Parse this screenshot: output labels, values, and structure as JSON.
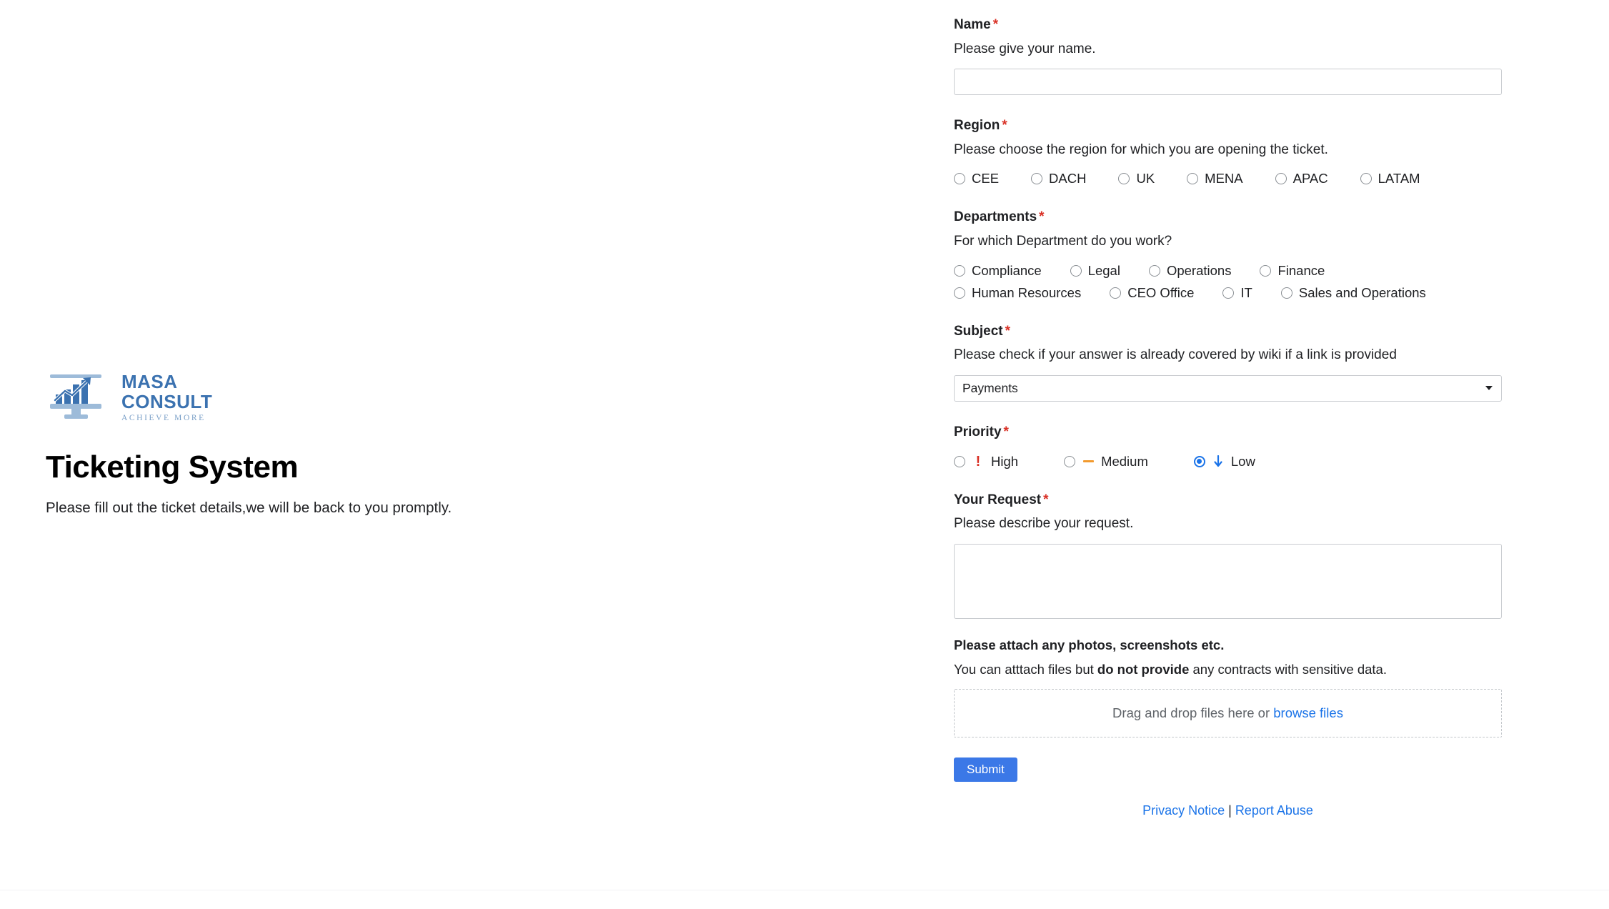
{
  "brand": {
    "logo_word_1": "MASA",
    "logo_word_2": "CONSULT",
    "logo_tagline": "ACHIEVE MORE",
    "logo_icon": "monitor-bar-chart-growth-icon",
    "title": "Ticketing System",
    "subtitle": "Please fill out the ticket details,we will be back to you promptly.",
    "brand_blue": "#3b72b0",
    "brand_light_blue": "#7ba0c8"
  },
  "form": {
    "required_marker": "*",
    "name": {
      "label": "Name",
      "help": "Please give your name.",
      "value": "",
      "placeholder": ""
    },
    "region": {
      "label": "Region",
      "help": "Please choose the region for which you are opening the ticket.",
      "options": [
        "CEE",
        "DACH",
        "UK",
        "MENA",
        "APAC",
        "LATAM"
      ],
      "selected": ""
    },
    "departments": {
      "label": "Departments",
      "help": "For which Department do you work?",
      "row1": [
        "Compliance",
        "Legal",
        "Operations",
        "Finance"
      ],
      "row2": [
        "Human Resources",
        "CEO Office",
        "IT",
        "Sales and Operations"
      ],
      "selected": ""
    },
    "subject": {
      "label": "Subject",
      "help": "Please check if your answer is already covered by wiki if a link is provided",
      "selected": "Payments",
      "caret_icon": "chevron-down-icon"
    },
    "priority": {
      "label": "Priority",
      "options": [
        {
          "label": "High",
          "icon": "exclamation-icon",
          "glyph": "!",
          "color": "#d93025",
          "checked": false
        },
        {
          "label": "Medium",
          "icon": "minus-dash-icon",
          "glyph": "—",
          "color": "#f29a2e",
          "checked": false
        },
        {
          "label": "Low",
          "icon": "arrow-down-icon",
          "glyph": "↓",
          "color": "#1a73e8",
          "checked": true
        }
      ],
      "selected": "Low"
    },
    "request": {
      "label": "Your Request",
      "help": "Please describe your request.",
      "value": "",
      "placeholder": ""
    },
    "attachments": {
      "title": "Please attach any photos, screenshots etc.",
      "note_prefix": "You can atttach files but ",
      "note_bold": "do not provide",
      "note_suffix": " any contracts with sensitive data.",
      "drop_text": "Drag and drop files here or ",
      "browse_label": "browse files"
    },
    "submit_label": "Submit"
  },
  "footer": {
    "privacy_label": "Privacy Notice",
    "separator": "|",
    "report_label": "Report Abuse",
    "link_color": "#1a73e8"
  }
}
